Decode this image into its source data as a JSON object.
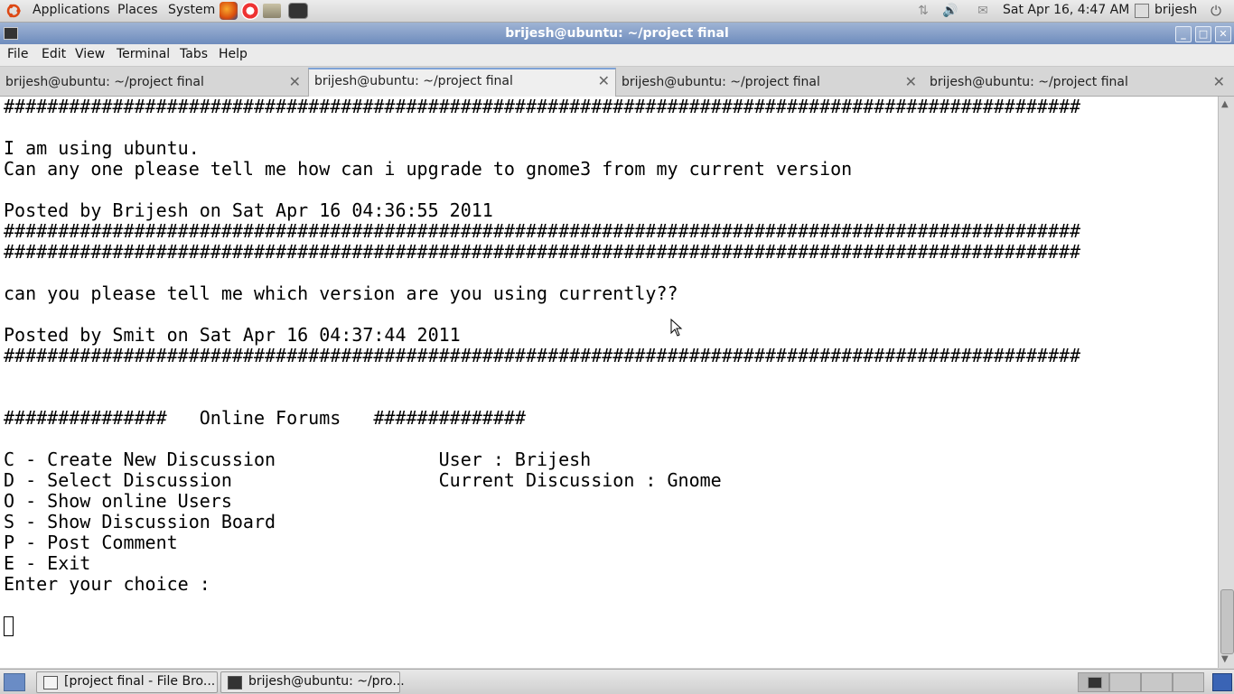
{
  "top_panel": {
    "menus": [
      "Applications",
      "Places",
      "System"
    ],
    "clock": "Sat Apr 16,  4:47 AM",
    "user": "brijesh"
  },
  "window": {
    "title": "brijesh@ubuntu: ~/project final"
  },
  "menubar": [
    "File",
    "Edit",
    "View",
    "Terminal",
    "Tabs",
    "Help"
  ],
  "tabs": [
    {
      "label": "brijesh@ubuntu: ~/project final",
      "active": false
    },
    {
      "label": "brijesh@ubuntu: ~/project final",
      "active": true
    },
    {
      "label": "brijesh@ubuntu: ~/project final",
      "active": false
    },
    {
      "label": "brijesh@ubuntu: ~/project final",
      "active": false
    }
  ],
  "terminal": {
    "text": "###################################################################################################\n\nI am using ubuntu.\nCan any one please tell me how can i upgrade to gnome3 from my current version\n\nPosted by Brijesh on Sat Apr 16 04:36:55 2011\n###################################################################################################\n###################################################################################################\n\ncan you please tell me which version are you using currently??\n\nPosted by Smit on Sat Apr 16 04:37:44 2011\n###################################################################################################\n\n\n###############   Online Forums   ##############\n\nC - Create New Discussion               User : Brijesh\nD - Select Discussion                   Current Discussion : Gnome\nO - Show online Users\nS - Show Discussion Board\nP - Post Comment\nE - Exit\nEnter your choice :"
  },
  "taskbar": [
    {
      "label": "[project final - File Bro..."
    },
    {
      "label": "brijesh@ubuntu: ~/pro..."
    }
  ]
}
